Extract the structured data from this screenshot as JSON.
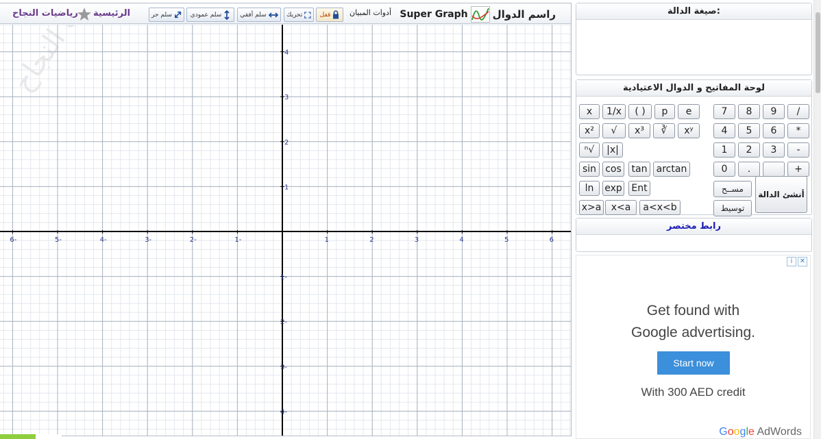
{
  "toolbar": {
    "brand_ar": "راسم الدوال",
    "brand_en": "Super Graph",
    "tools_label": "أدوات المبيان",
    "lock_label": "قفل",
    "move_label": "تحريك",
    "hscale_label": "سلم أفقي",
    "vscale_label": "سلم عمودي",
    "free_label": "سلم حر",
    "home_label": "الرئيسية",
    "site_label": "رياضيات النجاح"
  },
  "graph": {
    "x_ticks": [
      "6-",
      "5-",
      "4-",
      "3-",
      "2-",
      "1-",
      "1",
      "2",
      "3",
      "4",
      "5",
      "6"
    ],
    "y_ticks_pos": [
      "4",
      "3",
      "2",
      "1"
    ],
    "y_ticks_neg": [
      "1-",
      "2-",
      "3-",
      "4-"
    ],
    "watermark": "رياضيات النجاح",
    "colors": {
      "grid_minor": "#e3e7ee",
      "grid_major": "#a9b3bf",
      "axis": "#000000",
      "tick_label": "#2a3a8c"
    }
  },
  "formula_panel": {
    "title": "صيغة الدالة:"
  },
  "keypad": {
    "title": "لوحة المفاتيح و الدوال الاعتيادية",
    "func_rows": [
      [
        "x",
        "1/x",
        "( )",
        "p",
        "e"
      ],
      [
        "x²",
        "√",
        "x³",
        "∛",
        "xʸ"
      ],
      [
        "ⁿ√",
        "|x|"
      ],
      [
        "sin",
        "cos",
        "tan",
        "arctan"
      ],
      [
        "ln",
        "exp",
        "Ent"
      ],
      [
        "x>a",
        "x<a",
        "a<x<b"
      ]
    ],
    "num_rows": [
      [
        "7",
        "8",
        "9",
        "/"
      ],
      [
        "4",
        "5",
        "6",
        "*"
      ],
      [
        "1",
        "2",
        "3",
        "-"
      ],
      [
        "0",
        ".",
        "",
        "+"
      ]
    ],
    "clear_label": "مســح",
    "center_label": "توسيط",
    "create_label": "أنشئ الدالة"
  },
  "short_link": {
    "title": "رابط مختصر"
  },
  "ad": {
    "headline_1": "Get found with",
    "headline_2": "Google advertising.",
    "cta": "Start now",
    "credit": "With 300 AED credit",
    "brand_google": "Google",
    "brand_product": " AdWords"
  }
}
